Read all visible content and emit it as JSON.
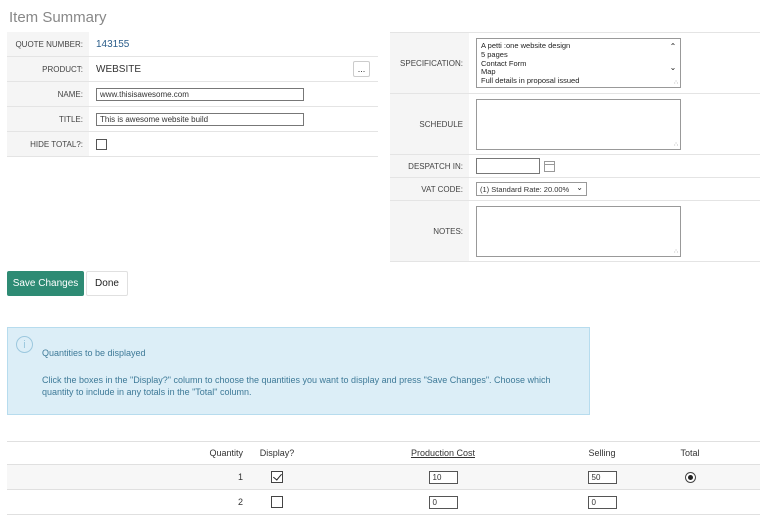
{
  "page_title": "Item Summary",
  "left_form": {
    "quote_number": {
      "label": "QUOTE NUMBER:",
      "value": "143155"
    },
    "product": {
      "label": "PRODUCT:",
      "value": "WEBSITE",
      "button": "..."
    },
    "name": {
      "label": "NAME:",
      "value": "www.thisisawesome.com"
    },
    "title": {
      "label": "TITLE:",
      "value": "This is awesome website build"
    },
    "hide_total": {
      "label": "HIDE TOTAL?:",
      "checked": false
    }
  },
  "right_form": {
    "specification": {
      "label": "SPECIFICATION:",
      "value": "A petti :one website design\n5 pages\nContact Form\nMap\nFull details in proposal issued"
    },
    "schedule": {
      "label": "SCHEDULE",
      "value": ""
    },
    "despatch_in": {
      "label": "DESPATCH IN:",
      "value": ""
    },
    "vat_code": {
      "label": "VAT CODE:",
      "value": "(1) Standard Rate: 20.00%"
    },
    "notes": {
      "label": "NOTES:",
      "value": ""
    }
  },
  "buttons": {
    "save": "Save Changes",
    "done": "Done"
  },
  "info": {
    "title": "Quantities to be displayed",
    "body": "Click the boxes in the \"Display?\" column to choose the quantities you want to display and press \"Save Changes\". Choose which quantity to include in any totals in the \"Total\" column."
  },
  "table": {
    "headers": {
      "quantity": "Quantity",
      "display": "Display?",
      "production_cost": "Production Cost",
      "selling": "Selling",
      "total": "Total"
    },
    "rows": [
      {
        "quantity": "1",
        "display": true,
        "production_cost": "10",
        "selling": "50",
        "total_selected": true
      },
      {
        "quantity": "2",
        "display": false,
        "production_cost": "0",
        "selling": "0",
        "total_selected": false
      }
    ]
  }
}
